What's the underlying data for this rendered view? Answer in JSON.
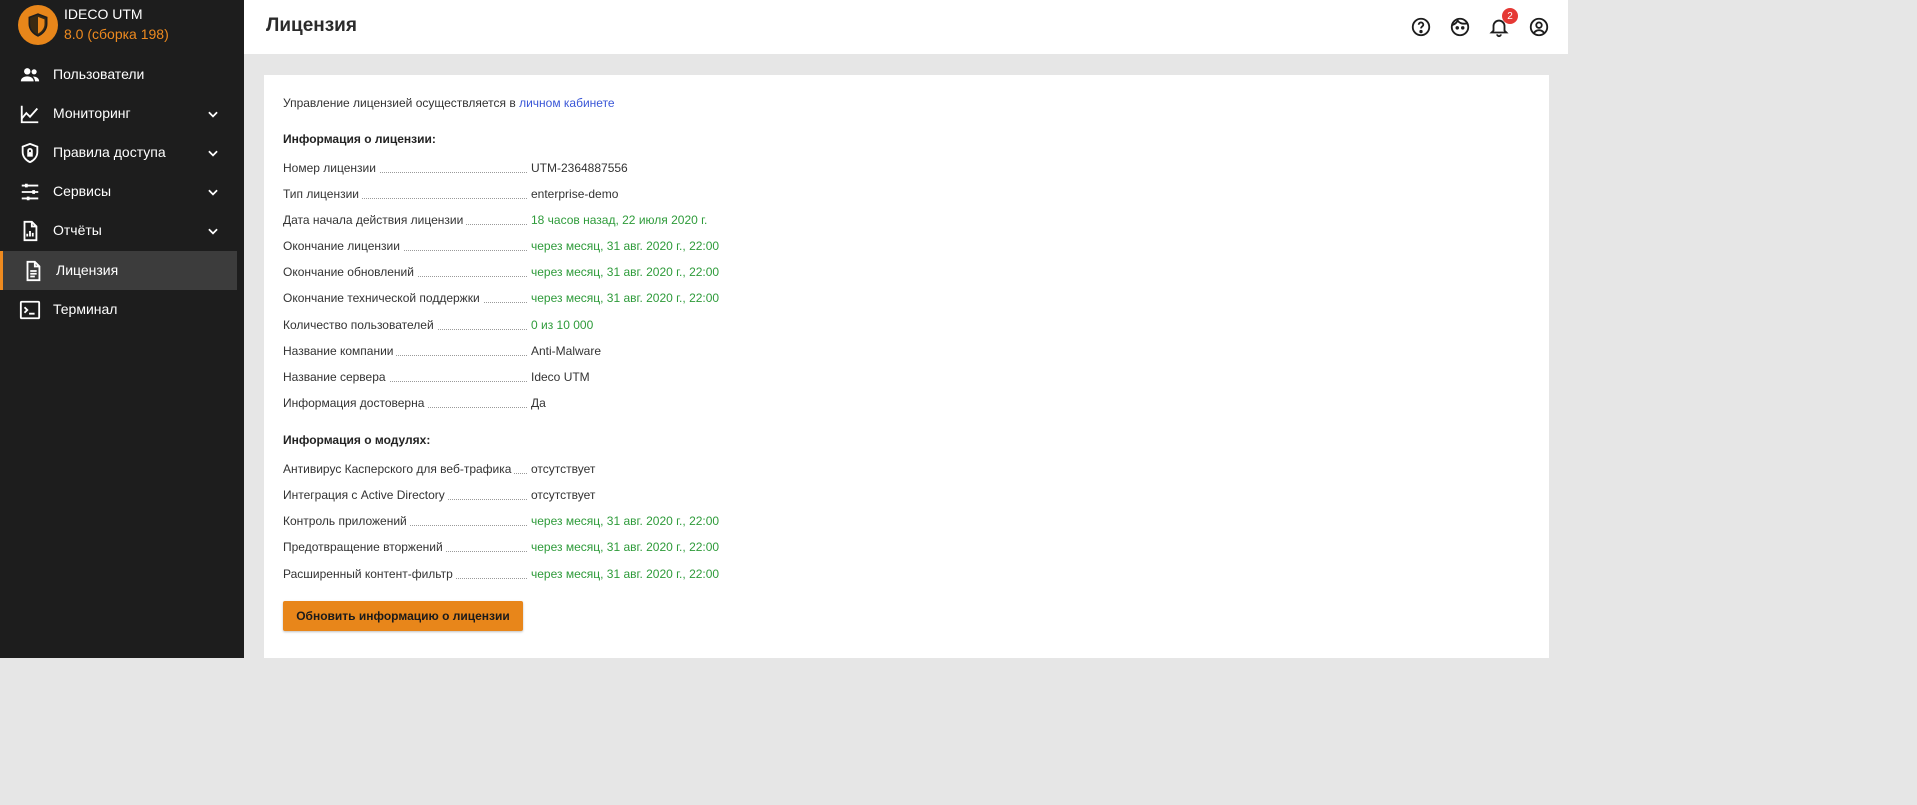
{
  "brand": {
    "name": "IDECO UTM",
    "version": "8.0 (сборка 198)",
    "logo_icon": "shield-icon"
  },
  "colors": {
    "sidebar_bg": "#1d1d1d",
    "accent": "#ee8a1f",
    "status_green": "#2e9b3a",
    "link": "#3a57d7",
    "badge": "#e53935"
  },
  "sidebar": {
    "items": [
      {
        "label": "Пользователи",
        "icon": "users-icon",
        "expandable": false
      },
      {
        "label": "Мониторинг",
        "icon": "chart-line-icon",
        "expandable": true
      },
      {
        "label": "Правила доступа",
        "icon": "shield-lock-icon",
        "expandable": true
      },
      {
        "label": "Сервисы",
        "icon": "sliders-icon",
        "expandable": true
      },
      {
        "label": "Отчёты",
        "icon": "report-icon",
        "expandable": true
      },
      {
        "label": "Лицензия",
        "icon": "document-icon",
        "expandable": false,
        "active": true
      },
      {
        "label": "Терминал",
        "icon": "terminal-icon",
        "expandable": false
      }
    ]
  },
  "header": {
    "title": "Лицензия",
    "icons": [
      "help-icon",
      "support-icon",
      "notifications-icon",
      "account-icon"
    ],
    "notification_count": "2"
  },
  "content": {
    "intro_text": "Управление лицензией осуществляется в ",
    "intro_link": "личном кабинете",
    "license_section_title": "Информация о лицензии:",
    "license_rows": [
      {
        "label": "Номер лицензии",
        "value": "UTM-2364887556",
        "status": "neutral"
      },
      {
        "label": "Тип лицензии",
        "value": "enterprise-demo",
        "status": "neutral"
      },
      {
        "label": "Дата начала действия лицензии",
        "value": "18 часов назад, 22 июля 2020 г.",
        "status": "ok"
      },
      {
        "label": "Окончание лицензии",
        "value": "через месяц, 31 авг. 2020 г., 22:00",
        "status": "ok"
      },
      {
        "label": "Окончание обновлений",
        "value": "через месяц, 31 авг. 2020 г., 22:00",
        "status": "ok"
      },
      {
        "label": "Окончание технической поддержки",
        "value": "через месяц, 31 авг. 2020 г., 22:00",
        "status": "ok"
      },
      {
        "label": "Количество пользователей",
        "value": "0 из 10 000",
        "status": "ok"
      },
      {
        "label": "Название компании",
        "value": "Anti-Malware",
        "status": "neutral"
      },
      {
        "label": "Название сервера",
        "value": "Ideco UTM",
        "status": "neutral"
      },
      {
        "label": "Информация достоверна",
        "value": "Да",
        "status": "neutral"
      }
    ],
    "modules_section_title": "Информация о модулях:",
    "module_rows": [
      {
        "label": "Антивирус Касперского для веб-трафика",
        "value": "отсутствует",
        "status": "neutral"
      },
      {
        "label": "Интеграция с Active Directory",
        "value": "отсутствует",
        "status": "neutral"
      },
      {
        "label": "Контроль приложений",
        "value": "через месяц, 31 авг. 2020 г., 22:00",
        "status": "ok"
      },
      {
        "label": "Предотвращение вторжений",
        "value": "через месяц, 31 авг. 2020 г., 22:00",
        "status": "ok"
      },
      {
        "label": "Расширенный контент-фильтр",
        "value": "через месяц, 31 авг. 2020 г., 22:00",
        "status": "ok"
      }
    ],
    "update_button_label": "Обновить информацию о лицензии"
  }
}
